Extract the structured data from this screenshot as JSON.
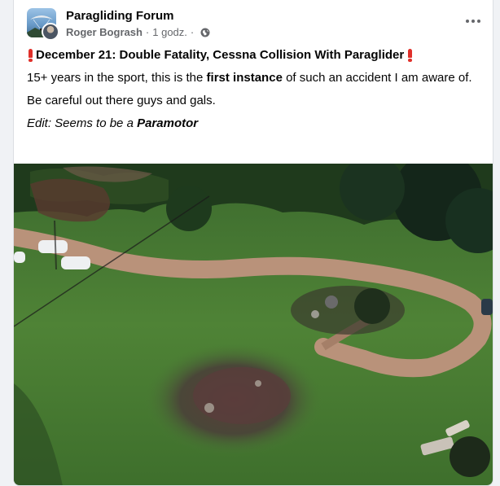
{
  "post": {
    "group_name": "Paragliding Forum",
    "author": "Roger Bogrash",
    "separator": "·",
    "time": "1 godz.",
    "privacy_icon": "globe-icon",
    "more_icon": "more-options-icon",
    "title": "December 21: Double Fatality, Cessna Collision With Paraglider",
    "title_icon": "red-exclamation-icon",
    "p1_before": "15+ years in the sport, this is the ",
    "p1_bold": "first instance",
    "p1_after": " of such an accident I am aware of.",
    "p2": "Be careful out there guys and gals.",
    "edit_prefix": "Edit: Seems to be a ",
    "edit_bold": "Paramotor",
    "image_description_icon": "aerial-crash-photo"
  },
  "colors": {
    "accent": "#e0302a",
    "text": "#050505",
    "muted": "#65676b",
    "grass": "#4a7a34",
    "road": "#b9927a"
  }
}
